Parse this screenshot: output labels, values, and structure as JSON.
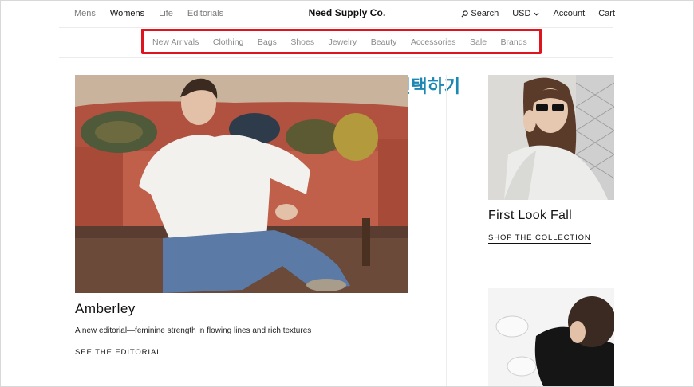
{
  "header": {
    "left_nav": [
      "Mens",
      "Womens",
      "Life",
      "Editorials"
    ],
    "active_left": "Womens",
    "brand": "Need Supply Co.",
    "right_nav": {
      "search": "Search",
      "currency": "USD",
      "account": "Account",
      "cart": "Cart"
    }
  },
  "categories": [
    "New Arrivals",
    "Clothing",
    "Bags",
    "Shoes",
    "Jewelry",
    "Beauty",
    "Accessories",
    "Sale",
    "Brands"
  ],
  "annotation": "카테고리 선택하기",
  "feature": {
    "title": "Amberley",
    "description": "A new editorial—feminine strength in flowing lines and rich textures",
    "link": "SEE THE EDITORIAL"
  },
  "side_feature": {
    "title": "First Look Fall",
    "link": "SHOP THE COLLECTION"
  },
  "colors": {
    "highlight_box": "#e0141e",
    "annotation_text": "#1c87b3"
  }
}
